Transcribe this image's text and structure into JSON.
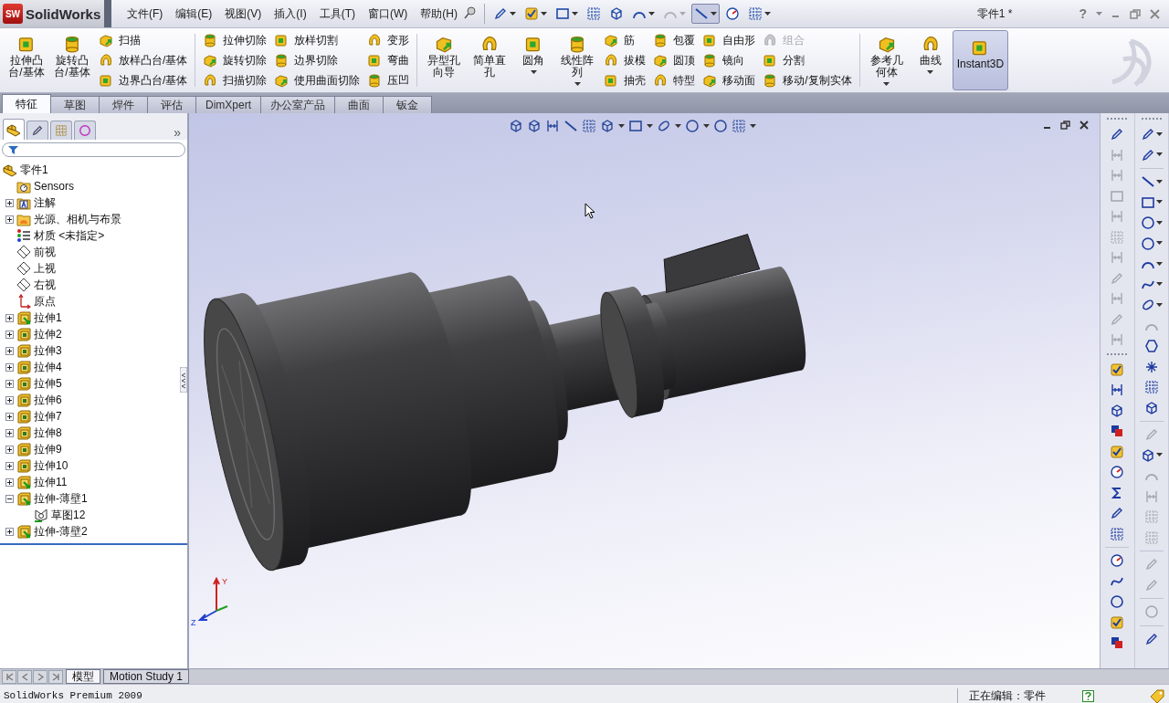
{
  "app_logo": {
    "badge": "SW",
    "name": "SolidWorks"
  },
  "menu": [
    {
      "label": "文件(F)"
    },
    {
      "label": "编辑(E)"
    },
    {
      "label": "视图(V)"
    },
    {
      "label": "插入(I)"
    },
    {
      "label": "工具(T)"
    },
    {
      "label": "窗口(W)"
    },
    {
      "label": "帮助(H)"
    }
  ],
  "quick_toolbar": [
    {
      "dropdown": true,
      "disabled": false,
      "selected": false
    },
    {
      "dropdown": true,
      "disabled": false,
      "selected": false
    },
    {
      "dropdown": true,
      "disabled": false,
      "selected": false
    },
    {
      "dropdown": false,
      "disabled": false,
      "selected": false
    },
    {
      "dropdown": false,
      "disabled": false,
      "selected": false
    },
    {
      "dropdown": true,
      "disabled": false,
      "selected": false
    },
    {
      "dropdown": true,
      "disabled": true,
      "selected": false
    },
    {
      "dropdown": true,
      "disabled": false,
      "selected": true
    },
    {
      "dropdown": false,
      "disabled": false,
      "selected": false
    },
    {
      "dropdown": true,
      "disabled": false,
      "selected": false
    }
  ],
  "document_title": "零件1 *",
  "help_button": "?",
  "ribbon": [
    {
      "kind": "large",
      "label": "拉伸凸台/基体",
      "dropdown": false,
      "selected": false
    },
    {
      "kind": "large",
      "label": "旋转凸台/基体",
      "dropdown": false,
      "selected": false
    },
    {
      "kind": "stack",
      "buttons": [
        {
          "label": "扫描",
          "disabled": false
        },
        {
          "label": "放样凸台/基体",
          "disabled": false
        },
        {
          "label": "边界凸台/基体",
          "disabled": false
        }
      ]
    },
    {
      "kind": "separator"
    },
    {
      "kind": "stack",
      "buttons": [
        {
          "label": "拉伸切除",
          "disabled": false
        },
        {
          "label": "旋转切除",
          "disabled": false
        },
        {
          "label": "扫描切除",
          "disabled": false
        }
      ]
    },
    {
      "kind": "stack",
      "buttons": [
        {
          "label": "放样切割",
          "disabled": false
        },
        {
          "label": "边界切除",
          "disabled": false
        },
        {
          "label": "使用曲面切除",
          "disabled": false
        }
      ]
    },
    {
      "kind": "stack",
      "buttons": [
        {
          "label": "变形",
          "disabled": false
        },
        {
          "label": "弯曲",
          "disabled": false
        },
        {
          "label": "压凹",
          "disabled": false
        }
      ]
    },
    {
      "kind": "separator"
    },
    {
      "kind": "large",
      "label": "异型孔向导",
      "dropdown": false,
      "selected": false
    },
    {
      "kind": "large",
      "label": "简单直孔",
      "dropdown": false,
      "selected": false
    },
    {
      "kind": "large",
      "label": "圆角",
      "dropdown": true,
      "selected": false
    },
    {
      "kind": "large",
      "label": "线性阵列",
      "dropdown": true,
      "selected": false
    },
    {
      "kind": "stack",
      "buttons": [
        {
          "label": "筋",
          "disabled": false
        },
        {
          "label": "拔模",
          "disabled": false
        },
        {
          "label": "抽壳",
          "disabled": false
        }
      ]
    },
    {
      "kind": "stack",
      "buttons": [
        {
          "label": "包覆",
          "disabled": false
        },
        {
          "label": "圆顶",
          "disabled": false
        },
        {
          "label": "特型",
          "disabled": false
        }
      ]
    },
    {
      "kind": "stack",
      "buttons": [
        {
          "label": "自由形",
          "disabled": false
        },
        {
          "label": "镜向",
          "disabled": false
        },
        {
          "label": "移动面",
          "disabled": false
        }
      ]
    },
    {
      "kind": "stack",
      "buttons": [
        {
          "label": "组合",
          "disabled": true
        },
        {
          "label": "分割",
          "disabled": false
        },
        {
          "label": "移动/复制实体",
          "disabled": false
        }
      ]
    },
    {
      "kind": "separator"
    },
    {
      "kind": "large",
      "label": "参考几何体",
      "dropdown": true,
      "selected": false
    },
    {
      "kind": "large",
      "label": "曲线",
      "dropdown": true,
      "selected": false
    },
    {
      "kind": "large",
      "label": "Instant3D",
      "dropdown": false,
      "selected": true
    }
  ],
  "tabs": [
    {
      "label": "特征",
      "selected": true
    },
    {
      "label": "草图",
      "selected": false
    },
    {
      "label": "焊件",
      "selected": false
    },
    {
      "label": "评估",
      "selected": false
    },
    {
      "label": "DimXpert",
      "selected": false
    },
    {
      "label": "办公室产品",
      "selected": false
    },
    {
      "label": "曲面",
      "selected": false
    },
    {
      "label": "钣金",
      "selected": false
    }
  ],
  "panel_tabs": [
    {
      "selected": true
    },
    {
      "selected": false
    },
    {
      "selected": false
    },
    {
      "selected": false
    }
  ],
  "panel_more": "»",
  "feature_tree": {
    "label": "零件1",
    "kind": "part",
    "children": [
      {
        "label": "Sensors",
        "kind": "sensors",
        "expandable": false
      },
      {
        "label": "注解",
        "kind": "annotations",
        "expandable": true,
        "expanded": false
      },
      {
        "label": "光源、相机与布景",
        "kind": "lights",
        "expandable": true,
        "expanded": false
      },
      {
        "label": "材质 <未指定>",
        "kind": "material",
        "expandable": false
      },
      {
        "label": "前视",
        "kind": "plane",
        "expandable": false
      },
      {
        "label": "上视",
        "kind": "plane",
        "expandable": false
      },
      {
        "label": "右视",
        "kind": "plane",
        "expandable": false
      },
      {
        "label": "原点",
        "kind": "origin",
        "expandable": false
      },
      {
        "label": "拉伸1",
        "kind": "boss",
        "expandable": true,
        "expanded": false
      },
      {
        "label": "拉伸2",
        "kind": "cut",
        "expandable": true,
        "expanded": false
      },
      {
        "label": "拉伸3",
        "kind": "cut",
        "expandable": true,
        "expanded": false
      },
      {
        "label": "拉伸4",
        "kind": "cut",
        "expandable": true,
        "expanded": false
      },
      {
        "label": "拉伸5",
        "kind": "cut",
        "expandable": true,
        "expanded": false
      },
      {
        "label": "拉伸6",
        "kind": "cut",
        "expandable": true,
        "expanded": false
      },
      {
        "label": "拉伸7",
        "kind": "cut",
        "expandable": true,
        "expanded": false
      },
      {
        "label": "拉伸8",
        "kind": "cut",
        "expandable": true,
        "expanded": false
      },
      {
        "label": "拉伸9",
        "kind": "cut",
        "expandable": true,
        "expanded": false
      },
      {
        "label": "拉伸10",
        "kind": "cut",
        "expandable": true,
        "expanded": false
      },
      {
        "label": "拉伸11",
        "kind": "boss",
        "expandable": true,
        "expanded": false
      },
      {
        "label": "拉伸-薄壁1",
        "kind": "boss",
        "expandable": true,
        "expanded": true,
        "children": [
          {
            "label": "草图12",
            "kind": "sketch",
            "expandable": false
          }
        ]
      },
      {
        "label": "拉伸-薄壁2",
        "kind": "boss",
        "expandable": true,
        "expanded": false
      }
    ]
  },
  "triad": {
    "y_label": "Y",
    "z_label": "Z"
  },
  "right_toolbars": [
    {
      "groups": [
        {
          "kind": "toolbar",
          "items": [
            {
              "disabled": false,
              "dropdown": false
            },
            {
              "disabled": true,
              "dropdown": false
            },
            {
              "disabled": true,
              "dropdown": false
            },
            {
              "disabled": true,
              "dropdown": false
            },
            {
              "disabled": true,
              "dropdown": false
            },
            {
              "disabled": true,
              "dropdown": false
            },
            {
              "disabled": true,
              "dropdown": false
            },
            {
              "disabled": true,
              "dropdown": false
            },
            {
              "disabled": true,
              "dropdown": false
            },
            {
              "disabled": true,
              "dropdown": false
            },
            {
              "disabled": true,
              "dropdown": false
            }
          ]
        },
        {
          "kind": "toolbar",
          "items": [
            {
              "disabled": false,
              "dropdown": false
            },
            {
              "disabled": false,
              "dropdown": false
            },
            {
              "disabled": false,
              "dropdown": false
            },
            {
              "disabled": false,
              "dropdown": false
            },
            {
              "disabled": false,
              "dropdown": false
            },
            {
              "disabled": false,
              "dropdown": false
            },
            {
              "disabled": false,
              "dropdown": false
            },
            {
              "disabled": false,
              "dropdown": false
            },
            {
              "disabled": false,
              "dropdown": false
            }
          ]
        },
        {
          "kind": "section",
          "items": [
            {
              "disabled": false,
              "dropdown": false
            },
            {
              "disabled": false,
              "dropdown": false
            },
            {
              "disabled": false,
              "dropdown": false
            },
            {
              "disabled": false,
              "dropdown": false
            },
            {
              "disabled": false,
              "dropdown": false
            }
          ]
        }
      ]
    },
    {
      "groups": [
        {
          "kind": "toolbar",
          "items": [
            {
              "disabled": false,
              "dropdown": true
            },
            {
              "disabled": false,
              "dropdown": true
            }
          ]
        },
        {
          "kind": "section",
          "items": [
            {
              "disabled": false,
              "dropdown": true
            },
            {
              "disabled": false,
              "dropdown": true
            },
            {
              "disabled": false,
              "dropdown": true
            },
            {
              "disabled": false,
              "dropdown": true
            },
            {
              "disabled": false,
              "dropdown": true
            },
            {
              "disabled": false,
              "dropdown": true
            },
            {
              "disabled": false,
              "dropdown": true
            },
            {
              "disabled": true,
              "dropdown": false
            },
            {
              "disabled": false,
              "dropdown": false
            },
            {
              "disabled": false,
              "dropdown": false
            },
            {
              "disabled": false,
              "dropdown": false
            },
            {
              "disabled": false,
              "dropdown": false
            }
          ]
        },
        {
          "kind": "section",
          "items": [
            {
              "disabled": true,
              "dropdown": false
            },
            {
              "disabled": false,
              "dropdown": true
            },
            {
              "disabled": true,
              "dropdown": false
            },
            {
              "disabled": true,
              "dropdown": false
            },
            {
              "disabled": true,
              "dropdown": false
            },
            {
              "disabled": true,
              "dropdown": false
            }
          ]
        },
        {
          "kind": "section",
          "items": [
            {
              "disabled": true,
              "dropdown": false
            },
            {
              "disabled": true,
              "dropdown": false
            }
          ]
        },
        {
          "kind": "section",
          "items": [
            {
              "disabled": true,
              "dropdown": false
            }
          ]
        },
        {
          "kind": "section",
          "items": [
            {
              "disabled": false,
              "dropdown": false
            }
          ]
        }
      ]
    }
  ],
  "bottom_tabs": [
    {
      "label": "模型",
      "selected": true
    },
    {
      "label": "Motion Study 1",
      "selected": false
    }
  ],
  "status_bar": {
    "product": "SolidWorks Premium 2009",
    "mode": "正在编辑：零件"
  }
}
